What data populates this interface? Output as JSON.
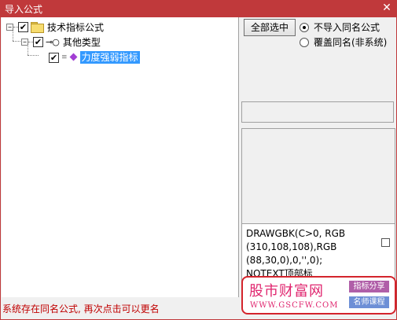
{
  "window": {
    "title": "导入公式",
    "close_glyph": "✕"
  },
  "tree": {
    "root": {
      "label": "技术指标公式",
      "checked": true,
      "expander": "−"
    },
    "child": {
      "label": "其他类型",
      "checked": true,
      "expander": "−"
    },
    "leaf": {
      "label": "力度强弱指标",
      "checked": true,
      "selected": true
    }
  },
  "controls": {
    "select_all_label": "全部选中",
    "radio_no_import": "不导入同名公式",
    "radio_overwrite": "覆盖同名(非系统)",
    "selected_option": "不导入同名公式"
  },
  "code": {
    "text": "DRAWGBK(C>0, RGB\n(310,108,108),RGB\n(88,30,0),0,'',0);\nNOTEXT顶部标"
  },
  "status": {
    "message": "系统存在同名公式, 再次点击可以更名"
  },
  "watermark": {
    "title": "股市财富网",
    "url": "WWW.GSCFW.COM",
    "tag1": "指标分享",
    "tag2": "名师课程"
  },
  "colors": {
    "titlebar": "#c0393b",
    "selection": "#3399ff",
    "status_text": "#c00000",
    "watermark_text": "#e0266f"
  }
}
